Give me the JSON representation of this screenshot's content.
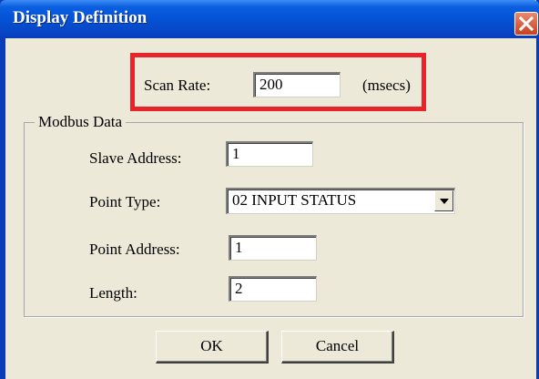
{
  "window": {
    "title": "Display Definition"
  },
  "scan": {
    "label": "Scan Rate:",
    "value": "200",
    "unit": "(msecs)"
  },
  "modbus": {
    "group_label": "Modbus Data",
    "slave_address": {
      "label": "Slave Address:",
      "value": "1"
    },
    "point_type": {
      "label": "Point Type:",
      "value": "02 INPUT STATUS"
    },
    "point_address": {
      "label": "Point Address:",
      "value": "1"
    },
    "length": {
      "label": "Length:",
      "value": "2"
    }
  },
  "buttons": {
    "ok": "OK",
    "cancel": "Cancel"
  },
  "colors": {
    "title_bar": "#0552d6",
    "highlight": "#e8242a",
    "dialog_bg": "#ece9d8"
  },
  "icons": {
    "close": "close-x-icon",
    "dropdown": "chevron-down-icon"
  }
}
